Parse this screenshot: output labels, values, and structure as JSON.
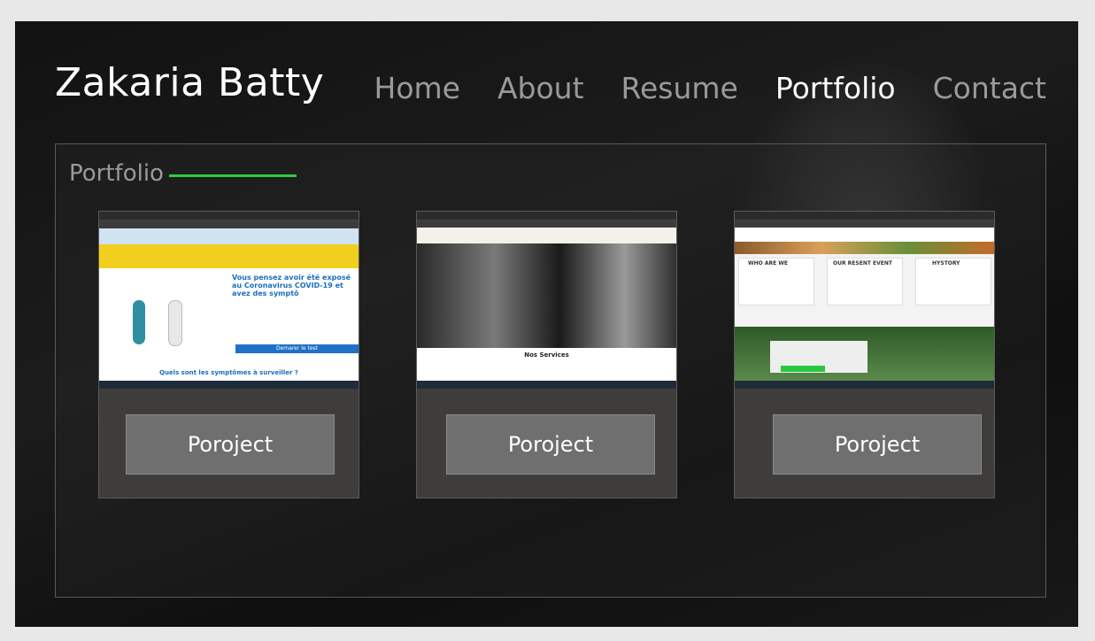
{
  "header": {
    "brand": "Zakaria Batty",
    "nav": [
      {
        "label": "Home"
      },
      {
        "label": "About"
      },
      {
        "label": "Resume"
      },
      {
        "label": "Portfolio"
      },
      {
        "label": "Contact"
      }
    ],
    "active_nav": "Portfolio"
  },
  "portfolio": {
    "title": "Portfolio",
    "accent_color": "#2ecc40",
    "cards": [
      {
        "button_label": "Poroject",
        "thumb_headline": "Vous pensez avoir été exposé au Coronavirus COVID-19 et avez des symptô",
        "thumb_cta": "Demarer le test",
        "thumb_footer": "Quels sont les symptômes à surveiller ?"
      },
      {
        "button_label": "Poroject",
        "thumb_section": "Nos Services"
      },
      {
        "button_label": "Poroject",
        "thumb_cols": [
          "WHO ARE WE",
          "OUR RESENT EVENT",
          "HYSTORY"
        ]
      }
    ]
  }
}
